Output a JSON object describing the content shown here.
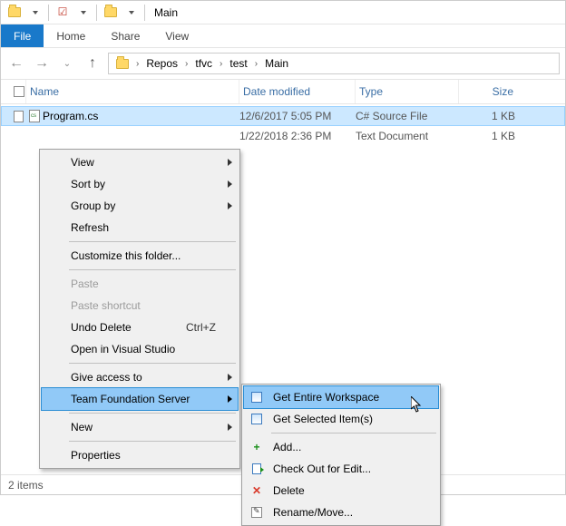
{
  "titlebar": {
    "title": "Main"
  },
  "ribbon": {
    "file": "File",
    "tabs": [
      "Home",
      "Share",
      "View"
    ]
  },
  "breadcrumb": {
    "items": [
      "Repos",
      "tfvc",
      "test",
      "Main"
    ]
  },
  "columns": {
    "name": "Name",
    "modified": "Date modified",
    "type": "Type",
    "size": "Size"
  },
  "rows": [
    {
      "name": "Program.cs",
      "modified": "12/6/2017 5:05 PM",
      "type": "C# Source File",
      "size": "1 KB",
      "selected": true
    },
    {
      "name": "",
      "modified": "1/22/2018 2:36 PM",
      "type": "Text Document",
      "size": "1 KB",
      "selected": false
    }
  ],
  "status": {
    "text": "2 items"
  },
  "contextMenu": {
    "items": [
      {
        "label": "View",
        "submenu": true
      },
      {
        "label": "Sort by",
        "submenu": true
      },
      {
        "label": "Group by",
        "submenu": true
      },
      {
        "label": "Refresh"
      },
      {
        "sep": true
      },
      {
        "label": "Customize this folder..."
      },
      {
        "sep": true
      },
      {
        "label": "Paste",
        "disabled": true
      },
      {
        "label": "Paste shortcut",
        "disabled": true
      },
      {
        "label": "Undo Delete",
        "shortcut": "Ctrl+Z"
      },
      {
        "label": "Open in Visual Studio"
      },
      {
        "sep": true
      },
      {
        "label": "Give access to",
        "submenu": true
      },
      {
        "label": "Team Foundation Server",
        "submenu": true,
        "highlight": true
      },
      {
        "sep": true
      },
      {
        "label": "New",
        "submenu": true
      },
      {
        "sep": true
      },
      {
        "label": "Properties"
      }
    ]
  },
  "tfsSubmenu": {
    "items": [
      {
        "icon": "workspace",
        "label": "Get Entire Workspace",
        "highlight": true
      },
      {
        "icon": "workspace",
        "label": "Get Selected Item(s)"
      },
      {
        "sep": true
      },
      {
        "icon": "plus",
        "label": "Add..."
      },
      {
        "icon": "checkout",
        "label": "Check Out for Edit..."
      },
      {
        "icon": "delete",
        "label": "Delete"
      },
      {
        "icon": "rename",
        "label": "Rename/Move..."
      }
    ]
  }
}
